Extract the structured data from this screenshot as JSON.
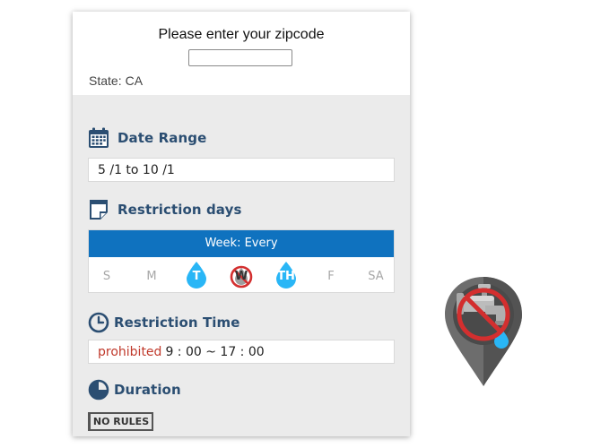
{
  "zipcode": {
    "prompt": "Please enter your zipcode",
    "value": ""
  },
  "state": {
    "label": "State:",
    "value": "CA"
  },
  "date_range": {
    "title": "Date Range",
    "value": "5 /1 to 10 /1"
  },
  "restriction_days": {
    "title": "Restriction days",
    "week_label": "Week: Every",
    "days": [
      {
        "label": "S",
        "status": "none"
      },
      {
        "label": "M",
        "status": "none"
      },
      {
        "label": "T",
        "status": "allowed"
      },
      {
        "label": "W",
        "status": "prohibited"
      },
      {
        "label": "TH",
        "status": "allowed"
      },
      {
        "label": "F",
        "status": "none"
      },
      {
        "label": "SA",
        "status": "none"
      }
    ]
  },
  "restriction_time": {
    "title": "Restriction Time",
    "prefix": "prohibited",
    "value": "9 : 00 ~ 17 : 00"
  },
  "duration": {
    "title": "Duration",
    "badge": "NO RULES"
  },
  "colors": {
    "heading": "#2b4e72",
    "week_bar": "#0f72bf",
    "drop": "#29b6f6",
    "prohibited": "#c0392b",
    "no_sign": "#d32f2f"
  },
  "icons": {
    "date_range": "calendar-icon",
    "restriction_days": "note-icon",
    "restriction_time": "clock-icon",
    "duration": "pie-icon",
    "map_marker": "no-water-faucet-pin-icon"
  }
}
